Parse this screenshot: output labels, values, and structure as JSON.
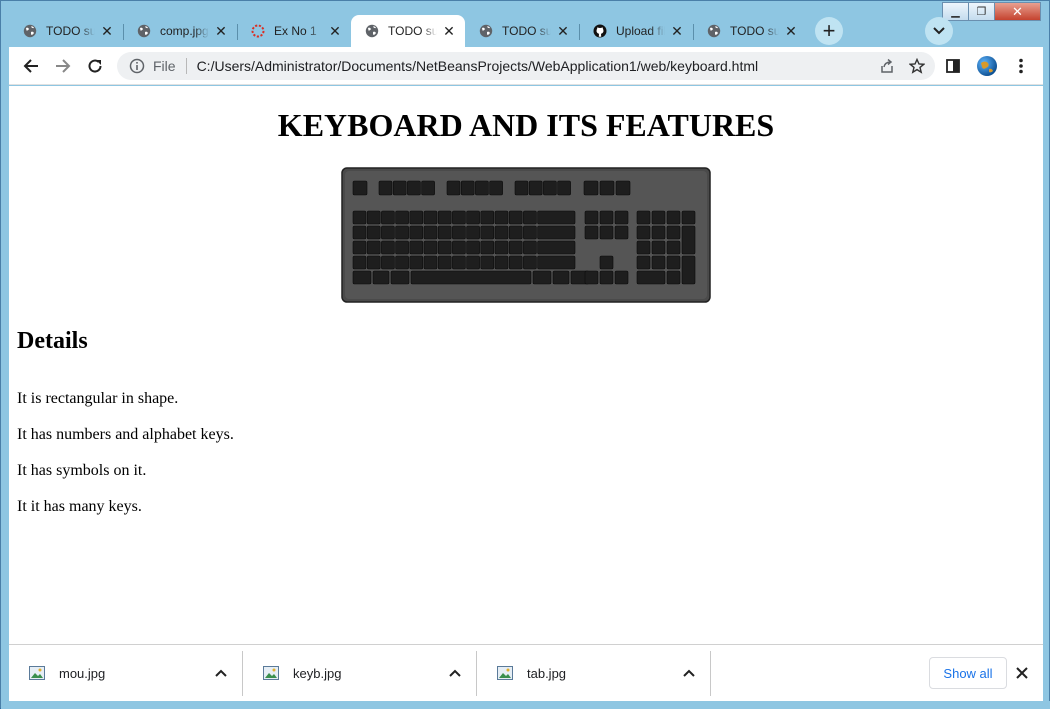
{
  "window": {
    "minimize_glyph": "▁",
    "maximize_glyph": "❐",
    "close_glyph": "✕"
  },
  "tabs": [
    {
      "title": "TODO supply a title",
      "icon": "globe-icon",
      "active": false
    },
    {
      "title": "comp.jpg",
      "icon": "globe-icon",
      "active": false
    },
    {
      "title": "Ex No 1",
      "icon": "loading-icon",
      "active": false
    },
    {
      "title": "TODO supply a title",
      "icon": "globe-icon",
      "active": true
    },
    {
      "title": "TODO supply a title",
      "icon": "globe-icon",
      "active": false
    },
    {
      "title": "Upload files",
      "icon": "github-icon",
      "active": false
    },
    {
      "title": "TODO supply a title",
      "icon": "globe-icon",
      "active": false
    }
  ],
  "tab_close_glyph": "✕",
  "new_tab_glyph": "+",
  "omnibox": {
    "scheme": "File",
    "url": "C:/Users/Administrator/Documents/NetBeansProjects/WebApplication1/web/keyboard.html"
  },
  "page": {
    "title": "KEYBOARD AND ITS FEATURES",
    "details_heading": "Details",
    "details": [
      "It is rectangular in shape.",
      "It has numbers and alphabet keys.",
      "It has symbols on it.",
      "It it has many keys."
    ]
  },
  "downloads": [
    {
      "filename": "mou.jpg"
    },
    {
      "filename": "keyb.jpg"
    },
    {
      "filename": "tab.jpg"
    }
  ],
  "show_all_label": "Show all",
  "colors": {
    "frame": "#8ec6e2",
    "show_all_text": "#1a73e8"
  }
}
